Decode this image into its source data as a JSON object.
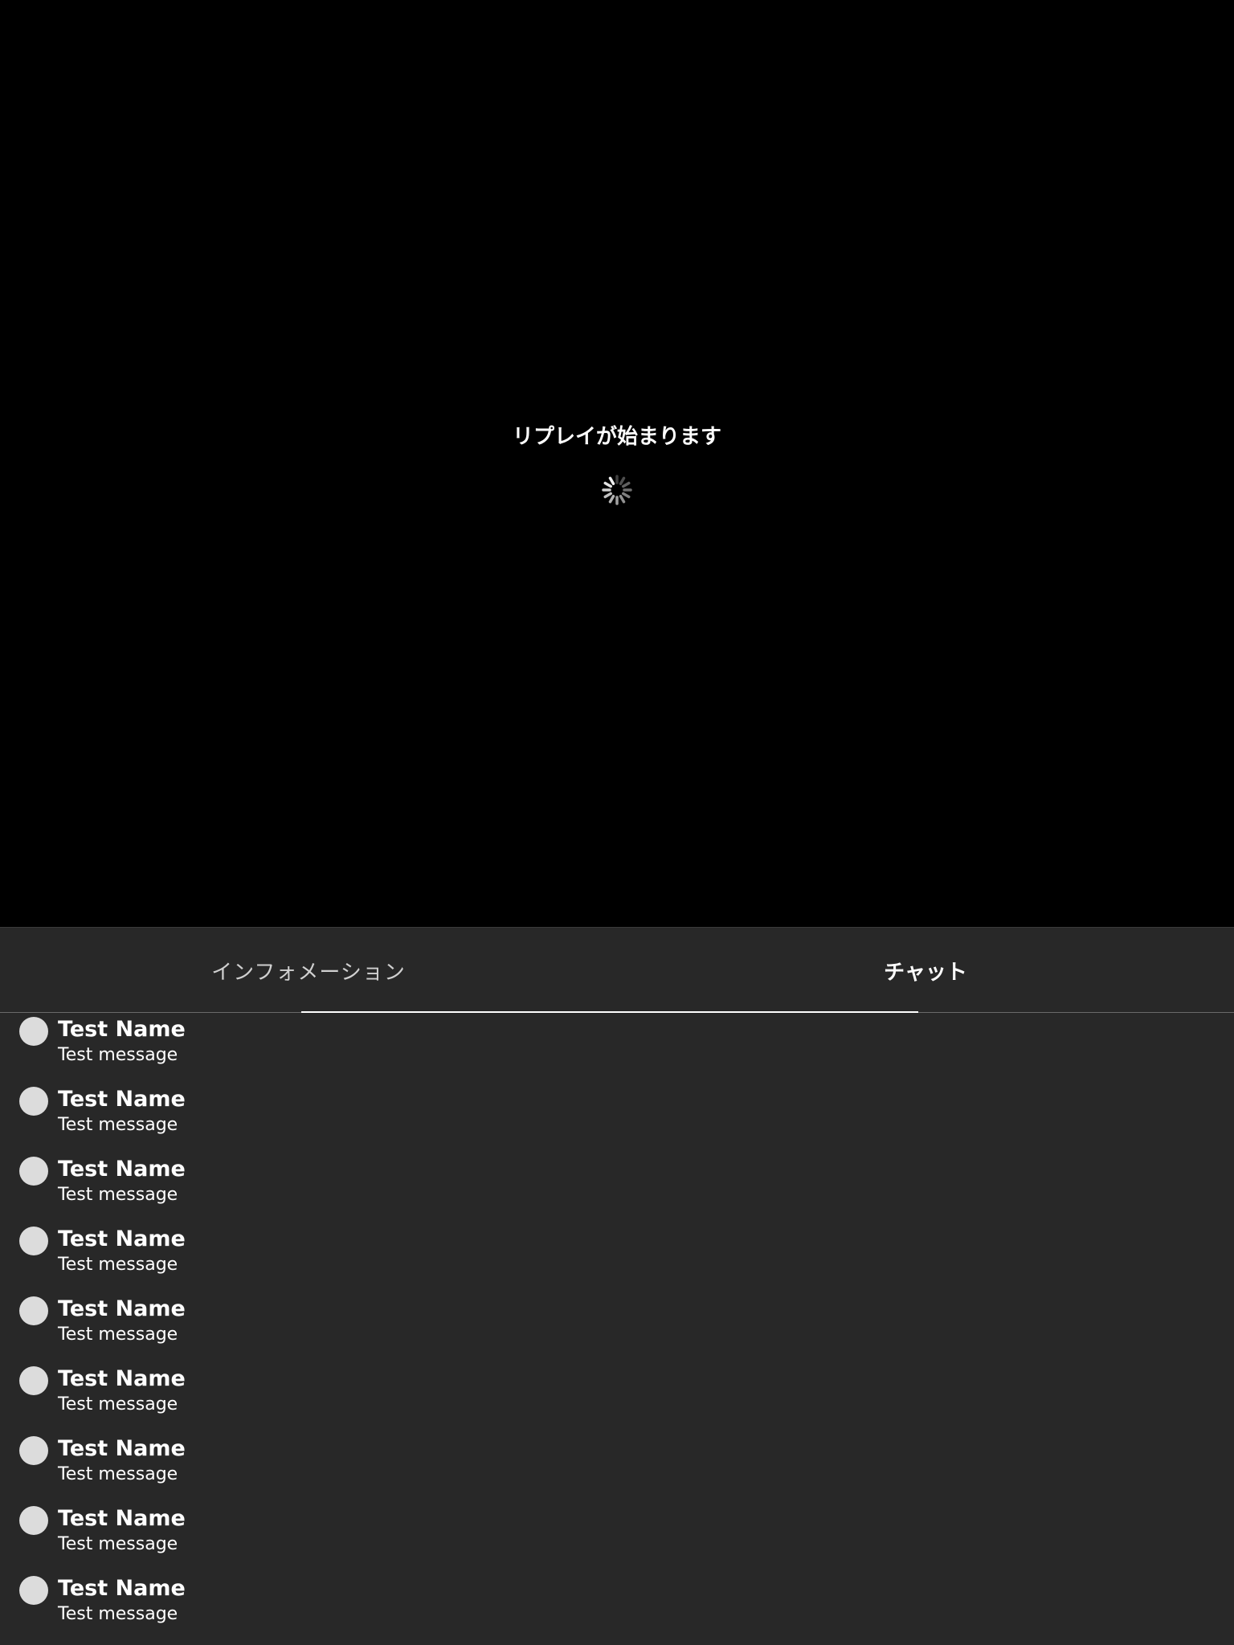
{
  "player": {
    "status_text": "リプレイが始まります",
    "spinner_icon": "loading-spinner-icon"
  },
  "tabs": [
    {
      "label": "インフォメーション",
      "selected": false
    },
    {
      "label": "チャット",
      "selected": true
    }
  ],
  "chat": {
    "messages": [
      {
        "name": "Test Name",
        "message": "Test message"
      },
      {
        "name": "Test Name",
        "message": "Test message"
      },
      {
        "name": "Test Name",
        "message": "Test message"
      },
      {
        "name": "Test Name",
        "message": "Test message"
      },
      {
        "name": "Test Name",
        "message": "Test message"
      },
      {
        "name": "Test Name",
        "message": "Test message"
      },
      {
        "name": "Test Name",
        "message": "Test message"
      },
      {
        "name": "Test Name",
        "message": "Test message"
      },
      {
        "name": "Test Name",
        "message": "Test message"
      }
    ]
  },
  "colors": {
    "player_background": "#000000",
    "panel_background": "#282828",
    "avatar": "#dcdcdc",
    "text": "#ffffff"
  }
}
